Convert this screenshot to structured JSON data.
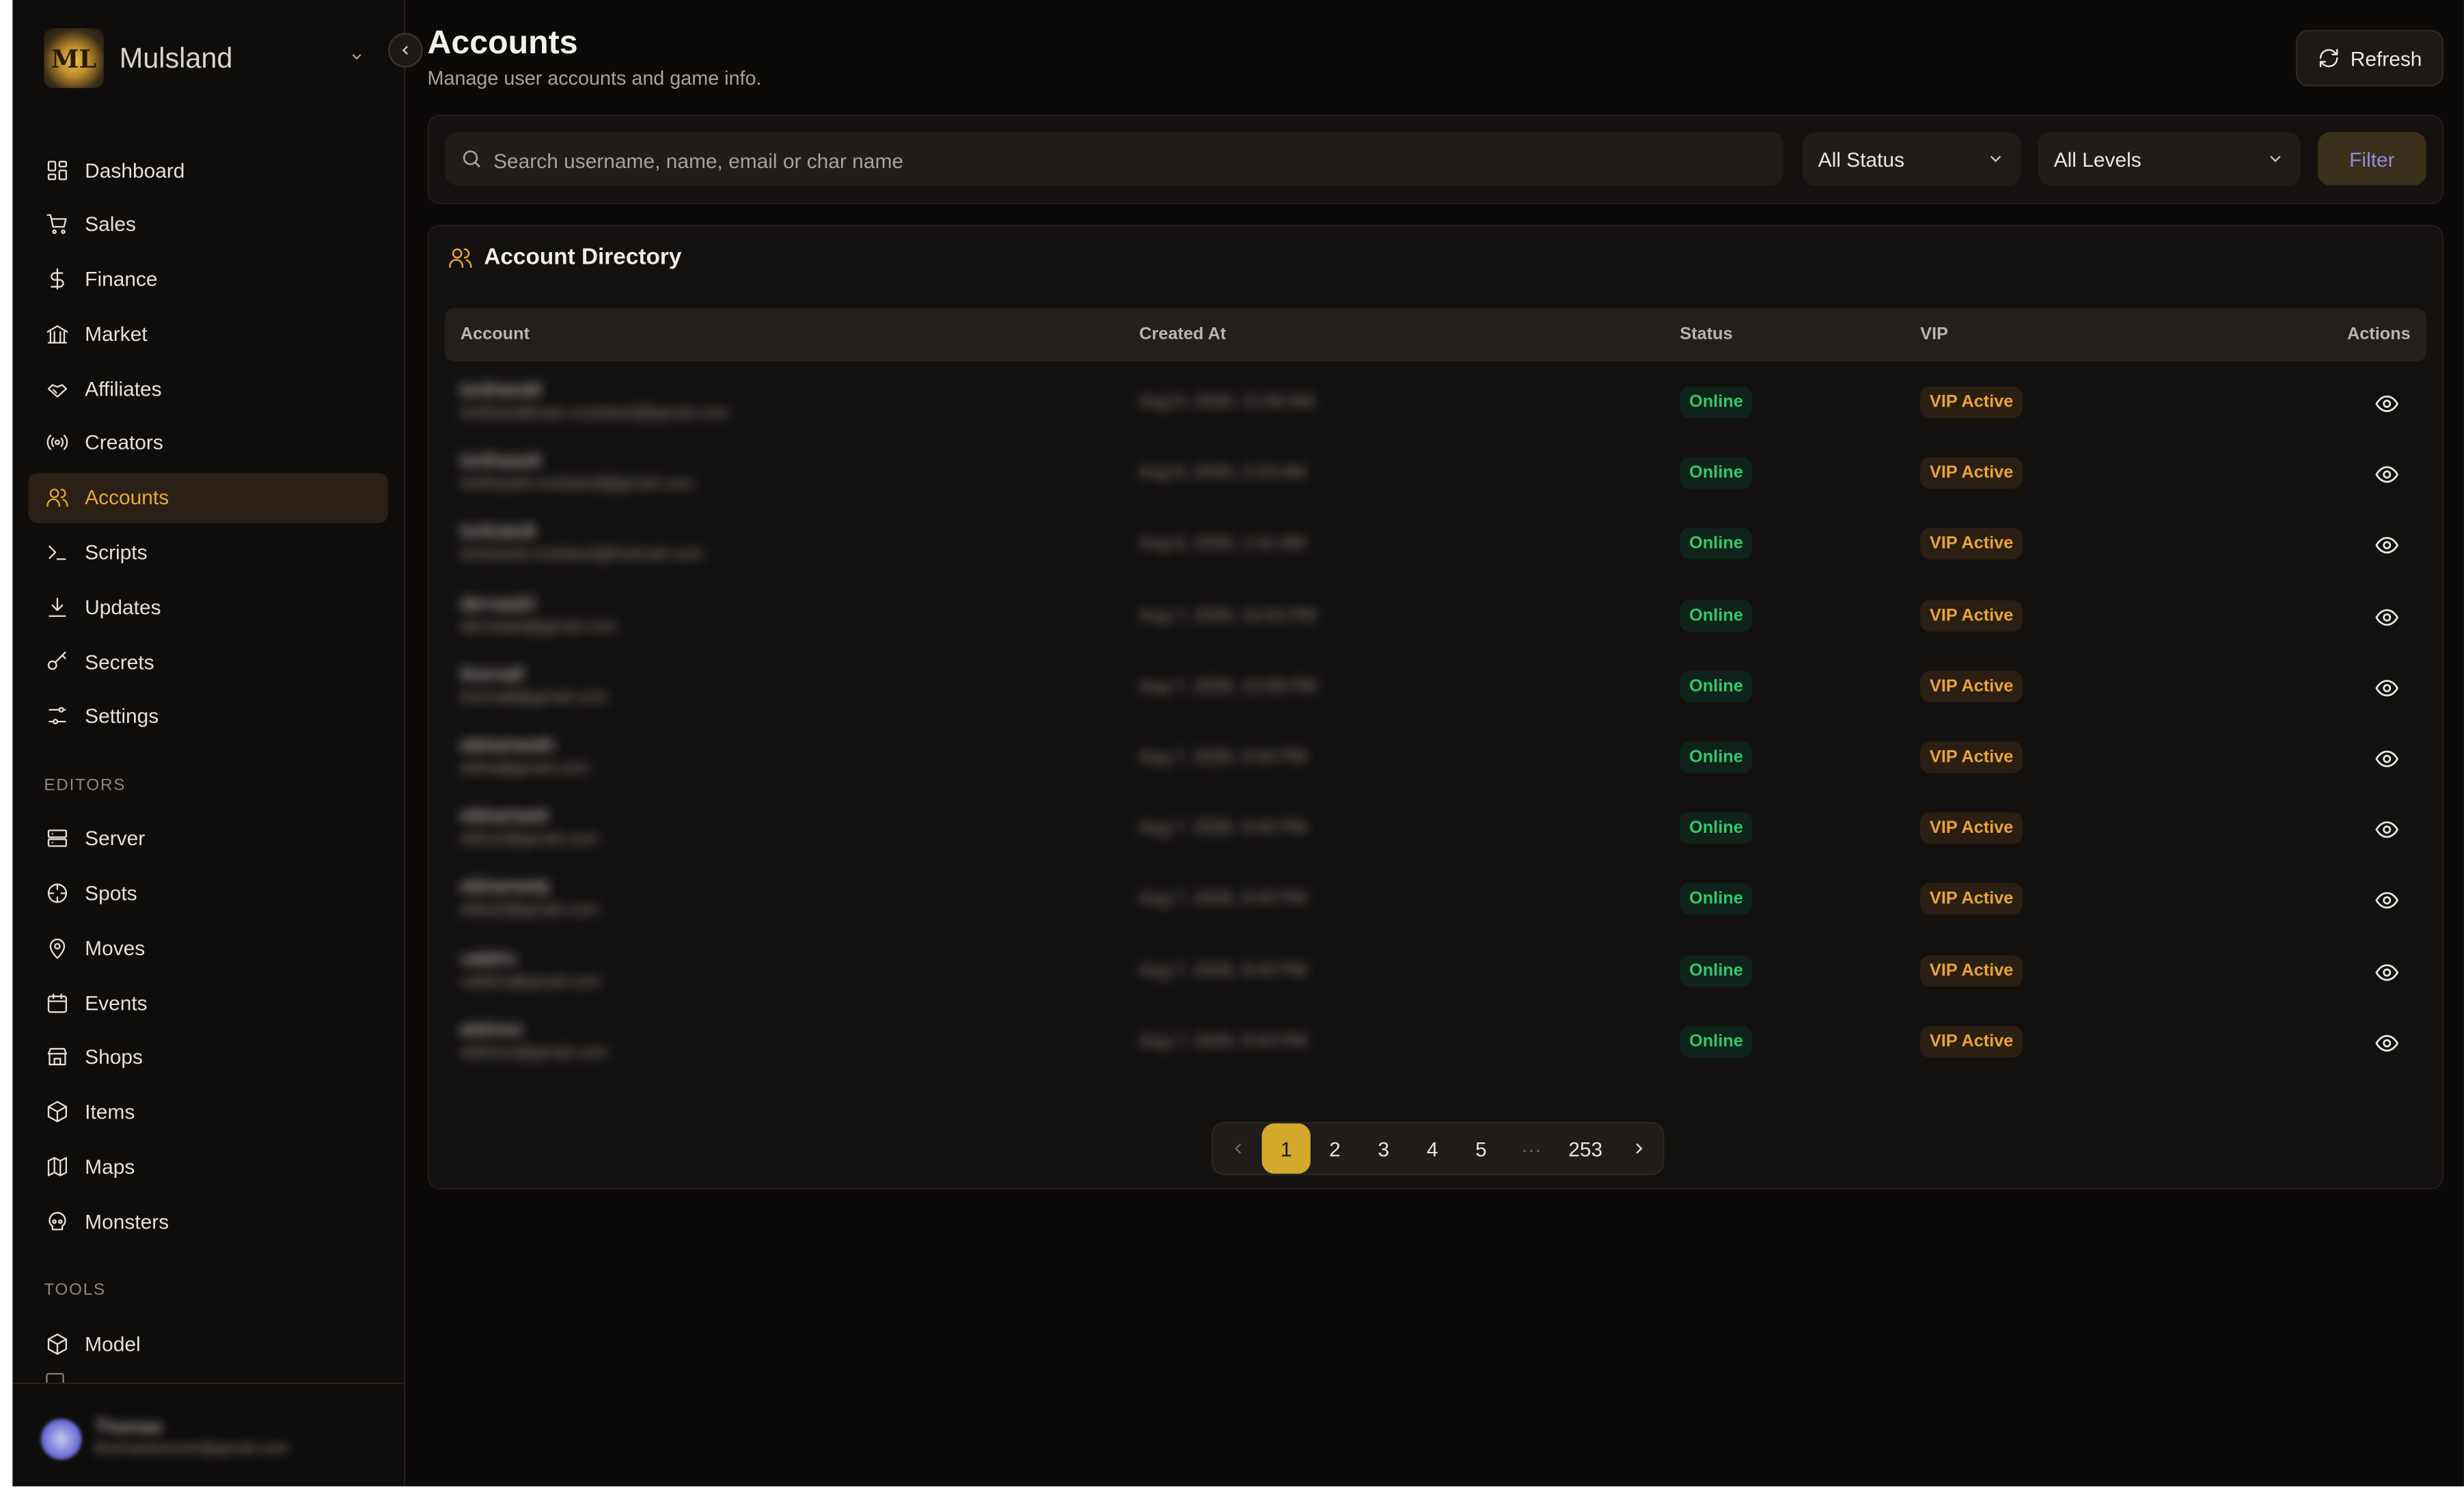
{
  "brand": {
    "name": "Mulsland",
    "logo_text": "ML"
  },
  "sidebar": {
    "main_items": [
      {
        "label": "Dashboard",
        "icon": "grid-icon"
      },
      {
        "label": "Sales",
        "icon": "cart-icon"
      },
      {
        "label": "Finance",
        "icon": "dollar-icon"
      },
      {
        "label": "Market",
        "icon": "bank-icon"
      },
      {
        "label": "Affiliates",
        "icon": "handshake-icon"
      },
      {
        "label": "Creators",
        "icon": "broadcast-icon"
      },
      {
        "label": "Accounts",
        "icon": "users-icon",
        "active": true
      },
      {
        "label": "Scripts",
        "icon": "terminal-icon"
      },
      {
        "label": "Updates",
        "icon": "download-icon"
      },
      {
        "label": "Secrets",
        "icon": "key-icon"
      },
      {
        "label": "Settings",
        "icon": "sliders-icon"
      }
    ],
    "editors_label": "EDITORS",
    "editor_items": [
      {
        "label": "Server",
        "icon": "server-icon"
      },
      {
        "label": "Spots",
        "icon": "target-icon"
      },
      {
        "label": "Moves",
        "icon": "map-pin-icon"
      },
      {
        "label": "Events",
        "icon": "calendar-icon"
      },
      {
        "label": "Shops",
        "icon": "store-icon"
      },
      {
        "label": "Items",
        "icon": "package-icon"
      },
      {
        "label": "Maps",
        "icon": "map-icon"
      },
      {
        "label": "Monsters",
        "icon": "skull-icon"
      }
    ],
    "tools_label": "TOOLS",
    "tool_items": [
      {
        "label": "Model",
        "icon": "cube-icon"
      }
    ],
    "user": {
      "name": "Thomas",
      "email": "thomasboisvert@gmail.com"
    }
  },
  "header": {
    "title": "Accounts",
    "subtitle": "Manage user accounts and game info.",
    "refresh_label": "Refresh"
  },
  "filters": {
    "search_placeholder": "Search username, name, email or char name",
    "status_value": "All Status",
    "level_value": "All Levels",
    "filter_label": "Filter"
  },
  "table": {
    "title": "Account Directory",
    "columns": [
      "Account",
      "Created At",
      "Status",
      "VIP",
      "Actions"
    ],
    "rows": [
      {
        "username": "lorithandil",
        "email": "lorithandilmain.mulsland@gmail.com",
        "created": "Aug 8, 2026, 11:56 AM",
        "status": "Online",
        "vip": "VIP Active"
      },
      {
        "username": "lorithaselt",
        "email": "lorithaselt.mulsland@gmail.com",
        "created": "Aug 8, 2026, 2:25 AM",
        "status": "Online",
        "vip": "VIP Active"
      },
      {
        "username": "lorikstedt",
        "email": "lorikstedt.mulsland@hotmail.com",
        "created": "Aug 8, 2026, 1:41 AM",
        "status": "Online",
        "vip": "VIP Active"
      },
      {
        "username": "dervaskil",
        "email": "dervaskil@gmail.com",
        "created": "Aug 7, 2026, 10:53 PM",
        "status": "Online",
        "vip": "VIP Active"
      },
      {
        "username": "thornalf",
        "email": "thornalf@gmail.com",
        "created": "Aug 7, 2026, 10:08 PM",
        "status": "Online",
        "vip": "VIP Active"
      },
      {
        "username": "eldrameeth",
        "email": "eldra@gmail.com",
        "created": "Aug 7, 2026, 9:44 PM",
        "status": "Online",
        "vip": "VIP Active"
      },
      {
        "username": "eldrameeti",
        "email": "eldra2@gmail.com",
        "created": "Aug 7, 2026, 9:44 PM",
        "status": "Online",
        "vip": "VIP Active"
      },
      {
        "username": "eldrameetj",
        "email": "eldra3@gmail.com",
        "created": "Aug 7, 2026, 9:44 PM",
        "status": "Online",
        "vip": "VIP Active"
      },
      {
        "username": "valdrin",
        "email": "valdrin@gmail.com",
        "created": "Aug 7, 2026, 9:44 PM",
        "status": "Online",
        "vip": "VIP Active"
      },
      {
        "username": "eldrinor",
        "email": "eldrinor@gmail.com",
        "created": "Aug 7, 2026, 9:44 PM",
        "status": "Online",
        "vip": "VIP Active"
      }
    ]
  },
  "pagination": {
    "pages": [
      "1",
      "2",
      "3",
      "4",
      "5"
    ],
    "ellipsis": "···",
    "last": "253",
    "current": "1"
  },
  "colors": {
    "accent": "#e6a93a",
    "online": "#34c76b",
    "vip": "#eaa33a",
    "page_active": "#d4a82a",
    "filter_text": "#8f8ce6",
    "background": "#0c0a09"
  }
}
